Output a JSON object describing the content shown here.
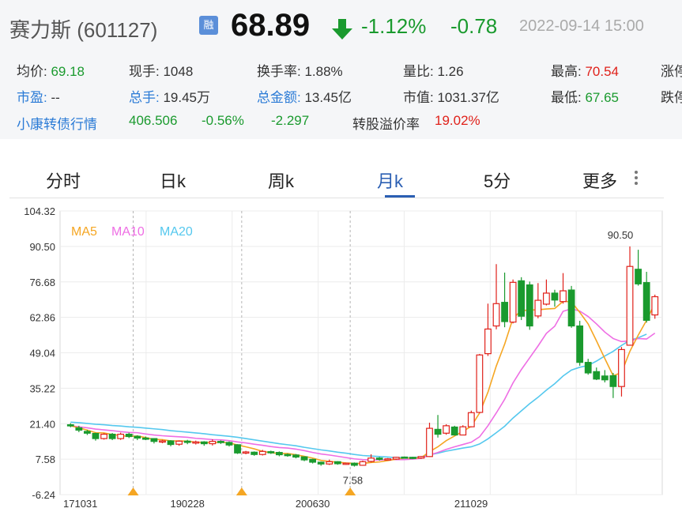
{
  "header": {
    "stock_name": "赛力斯 (601127)",
    "rong_badge": "融",
    "price": "68.89",
    "change_pct": "-1.12%",
    "change_abs": "-0.78",
    "datetime": "2022-09-14 15:00"
  },
  "stats": {
    "row1": [
      {
        "label": "均价:",
        "value": "69.18",
        "color": "green"
      },
      {
        "label": "现手:",
        "value": "1048"
      },
      {
        "label": "换手率:",
        "value": "1.88%"
      },
      {
        "label": "量比:",
        "value": "1.26"
      },
      {
        "label": "最高:",
        "value": "70.54",
        "color": "red"
      },
      {
        "label": "涨停"
      }
    ],
    "row2": [
      {
        "label": "市盈:",
        "value": "--",
        "blue": true
      },
      {
        "label": "总手:",
        "value": "19.45万",
        "blue": true
      },
      {
        "label": "总金额:",
        "value": "13.45亿",
        "blue": true
      },
      {
        "label": "市值:",
        "value": "1031.37亿"
      },
      {
        "label": "最低:",
        "value": "67.65",
        "color": "green"
      },
      {
        "label": "跌停"
      }
    ],
    "row3": {
      "label": "小康转债行情",
      "price": "406.506",
      "pct": "-0.56%",
      "chg": "-2.297",
      "premium_label": "转股溢价率",
      "premium_value": "19.02%"
    }
  },
  "tabs": [
    "分时",
    "日k",
    "周k",
    "月k",
    "5分",
    "更多"
  ],
  "active_tab": "月k",
  "colors": {
    "up": "#e0211a",
    "down": "#1a9a2e",
    "ma5": "#f5a623",
    "ma10": "#ee6ee4",
    "ma20": "#55c8ee",
    "link": "#2b7bd6"
  },
  "chart_data": {
    "type": "candlestick",
    "ylim": [
      -6.24,
      104.32
    ],
    "y_ticks": [
      "104.32",
      "90.50",
      "76.68",
      "62.86",
      "49.04",
      "35.22",
      "21.40",
      "7.58",
      "-6.24"
    ],
    "x_ticks": [
      "171031",
      "190228",
      "200630",
      "211029"
    ],
    "legend": [
      "MA5",
      "MA10",
      "MA20"
    ],
    "annotations": {
      "max": "90.50",
      "min": "7.58"
    },
    "candles": [
      [
        21.0,
        20.6,
        21.6,
        20.0
      ],
      [
        19.8,
        18.9,
        20.6,
        18.1
      ],
      [
        18.4,
        17.7,
        19.0,
        17.0
      ],
      [
        17.6,
        15.6,
        17.9,
        14.8
      ],
      [
        15.6,
        17.3,
        17.7,
        15.2
      ],
      [
        17.3,
        15.6,
        17.8,
        15.0
      ],
      [
        15.6,
        17.3,
        17.9,
        15.1
      ],
      [
        17.3,
        16.4,
        17.9,
        15.8
      ],
      [
        16.5,
        15.8,
        16.9,
        15.0
      ],
      [
        15.8,
        15.6,
        16.4,
        15.0
      ],
      [
        15.6,
        14.5,
        15.7,
        13.7
      ],
      [
        14.6,
        14.7,
        15.1,
        13.8
      ],
      [
        14.7,
        13.3,
        15.0,
        12.6
      ],
      [
        13.4,
        14.6,
        14.9,
        12.8
      ],
      [
        14.6,
        14.1,
        15.1,
        13.4
      ],
      [
        14.1,
        14.3,
        14.8,
        13.3
      ],
      [
        14.3,
        13.6,
        14.6,
        12.8
      ],
      [
        13.6,
        14.5,
        15.3,
        12.9
      ],
      [
        14.5,
        14.1,
        14.9,
        13.5
      ],
      [
        14.1,
        13.1,
        14.5,
        12.5
      ],
      [
        13.2,
        10.0,
        13.4,
        9.6
      ],
      [
        10.0,
        10.4,
        10.8,
        9.5
      ],
      [
        10.3,
        9.4,
        10.6,
        8.9
      ],
      [
        9.4,
        10.6,
        11.2,
        9.0
      ],
      [
        10.5,
        10.3,
        10.9,
        9.6
      ],
      [
        10.2,
        9.3,
        10.6,
        8.7
      ],
      [
        9.4,
        9.2,
        9.8,
        8.5
      ],
      [
        9.2,
        8.4,
        9.6,
        7.9
      ],
      [
        8.5,
        7.3,
        8.7,
        6.8
      ],
      [
        7.5,
        6.4,
        7.7,
        5.9
      ],
      [
        6.4,
        5.7,
        6.6,
        5.0
      ],
      [
        5.7,
        6.6,
        7.4,
        5.3
      ],
      [
        6.6,
        5.8,
        6.8,
        5.4
      ],
      [
        5.8,
        6.0,
        6.2,
        5.4
      ],
      [
        6.0,
        5.2,
        6.3,
        4.7
      ],
      [
        5.2,
        6.6,
        7.0,
        5.0
      ],
      [
        6.7,
        8.0,
        9.5,
        6.3
      ],
      [
        8.0,
        7.5,
        8.4,
        7.0
      ],
      [
        7.6,
        7.7,
        8.0,
        7.2
      ],
      [
        7.6,
        8.3,
        8.5,
        7.3
      ],
      [
        8.4,
        8.2,
        8.6,
        7.8
      ],
      [
        8.3,
        8.0,
        8.5,
        7.6
      ],
      [
        8.0,
        8.6,
        8.8,
        7.7
      ],
      [
        8.6,
        19.6,
        21.8,
        8.4
      ],
      [
        19.2,
        17.3,
        24.8,
        16.0
      ],
      [
        17.7,
        20.6,
        21.2,
        17.1
      ],
      [
        20.1,
        17.0,
        20.6,
        16.8
      ],
      [
        17.0,
        20.2,
        20.8,
        16.9
      ],
      [
        20.2,
        25.7,
        26.5,
        20.0
      ],
      [
        25.8,
        48.2,
        48.6,
        25.5
      ],
      [
        48.7,
        58.3,
        68.2,
        47.8
      ],
      [
        59.5,
        68.2,
        83.6,
        58.2
      ],
      [
        68.7,
        61.2,
        80.3,
        59.0
      ],
      [
        61.0,
        76.5,
        77.6,
        60.5
      ],
      [
        77.1,
        63.3,
        78.5,
        61.8
      ],
      [
        75.5,
        59.5,
        76.8,
        58.0
      ],
      [
        63.4,
        69.5,
        76.2,
        62.5
      ],
      [
        68.0,
        72.3,
        77.6,
        67.5
      ],
      [
        72.3,
        69.6,
        73.6,
        67.0
      ],
      [
        69.0,
        73.2,
        80.1,
        68.2
      ],
      [
        73.5,
        59.5,
        75.1,
        58.8
      ],
      [
        59.5,
        45.3,
        61.5,
        44.0
      ],
      [
        45.3,
        41.2,
        46.7,
        40.5
      ],
      [
        41.7,
        38.8,
        43.3,
        38.4
      ],
      [
        40.0,
        38.5,
        42.3,
        37.5
      ],
      [
        40.1,
        35.9,
        41.2,
        31.4
      ],
      [
        35.9,
        50.3,
        51.3,
        32.0
      ],
      [
        52.0,
        82.7,
        90.5,
        53.0
      ],
      [
        81.6,
        75.9,
        89.2,
        75.2
      ],
      [
        76.4,
        61.7,
        80.6,
        60.8
      ],
      [
        63.8,
        70.9,
        71.7,
        62.3
      ]
    ],
    "ma5": [
      20.6,
      19.8,
      18.9,
      17.9,
      17.8,
      17.2,
      16.8,
      16.4,
      16.6,
      16.0,
      15.3,
      15.2,
      14.7,
      14.7,
      14.6,
      14.2,
      14.1,
      14.0,
      14.2,
      13.9,
      13.1,
      12.4,
      11.6,
      10.6,
      10.1,
      9.8,
      9.8,
      9.3,
      8.7,
      8.0,
      7.1,
      6.7,
      6.4,
      6.1,
      5.9,
      5.9,
      6.3,
      6.5,
      7.0,
      7.6,
      8.0,
      8.0,
      8.1,
      10.5,
      12.4,
      14.8,
      16.6,
      18.4,
      20.4,
      25.6,
      33.7,
      43.9,
      52.4,
      62.5,
      65.5,
      65.7,
      65.8,
      66.1,
      66.3,
      69.1,
      68.9,
      64.8,
      60.3,
      53.7,
      46.8,
      40.1,
      41.3,
      49.6,
      55.9,
      61.7,
      68.3
    ],
    "ma10": [
      20.6,
      20.2,
      19.8,
      19.3,
      19.0,
      18.7,
      18.3,
      18.0,
      17.9,
      17.4,
      17.0,
      16.7,
      16.5,
      16.3,
      16.1,
      15.7,
      15.5,
      15.2,
      15.1,
      14.8,
      14.3,
      13.9,
      13.4,
      13.0,
      12.5,
      12.1,
      11.9,
      11.5,
      10.9,
      10.2,
      9.6,
      9.2,
      8.7,
      8.2,
      7.7,
      7.4,
      7.3,
      7.3,
      7.4,
      7.4,
      7.4,
      7.6,
      7.9,
      9.2,
      10.2,
      11.4,
      12.4,
      13.3,
      14.2,
      16.3,
      20.6,
      25.6,
      30.9,
      37.3,
      42.5,
      47.1,
      51.7,
      56.6,
      59.4,
      65.2,
      66.2,
      65.3,
      63.2,
      60.3,
      57.1,
      54.6,
      53.4,
      53.7,
      54.6,
      54.4,
      56.7
    ],
    "ma20": [
      22.0,
      21.8,
      21.5,
      21.2,
      21.0,
      20.7,
      20.5,
      20.2,
      20.0,
      19.7,
      19.4,
      19.1,
      18.7,
      18.4,
      18.1,
      17.8,
      17.5,
      17.1,
      16.8,
      16.5,
      16.1,
      15.6,
      15.1,
      14.6,
      14.1,
      13.6,
      13.2,
      12.8,
      12.2,
      11.7,
      11.2,
      10.8,
      10.3,
      9.9,
      9.4,
      9.0,
      8.8,
      8.6,
      8.4,
      8.2,
      8.1,
      8.2,
      8.5,
      9.3,
      9.9,
      10.7,
      11.3,
      11.9,
      12.4,
      13.5,
      15.5,
      17.9,
      20.4,
      23.6,
      26.4,
      29.2,
      31.7,
      34.5,
      37.0,
      40.0,
      42.3,
      43.4,
      44.1,
      45.8,
      47.8,
      49.6,
      51.9,
      53.9,
      54.9,
      56.3
    ],
    "ma_start_index": 0
  }
}
